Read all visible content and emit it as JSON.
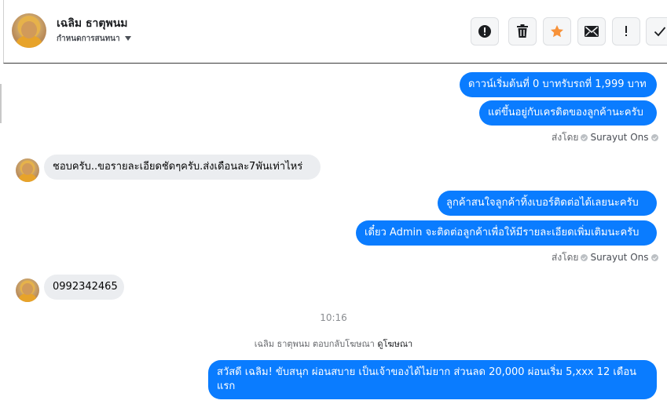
{
  "header": {
    "contact_name": "เฉลิม ธาตุพนม",
    "status_label": "กำหนดการสนทนา",
    "actions": [
      {
        "icon": "alert-circle-icon",
        "tooltip": "Spam"
      },
      {
        "icon": "trash-icon",
        "tooltip": "Delete"
      },
      {
        "icon": "star-icon",
        "tooltip": "Star",
        "color": "#f7923a"
      },
      {
        "icon": "envelope-icon",
        "tooltip": "Mark unread"
      },
      {
        "icon": "exclamation-icon",
        "tooltip": "Follow up"
      },
      {
        "icon": "check-icon",
        "tooltip": "Done"
      }
    ]
  },
  "messages": {
    "m1": "ดาวน์เริ่มต้นที่ 0 บาทรับรถที่ 1,999 บาท",
    "m2": "แต่ขึ้นอยู่กับเครดิตของลูกค้านะครับ",
    "sent_by_1": {
      "prefix": "ส่งโดย",
      "author": "Surayut Ons"
    },
    "m3": "ชอบครับ..ขอรายละเอียดชัดๆครับ.ส่งเดือนละ7พันเท่าไหร่",
    "m4": "ลูกค้าสนใจลูกค้าทิ้งเบอร์ติดต่อได้เลยนะครับ",
    "m5": "เดี๋ยว Admin จะติดต่อลูกค้าเพื่อให้มีรายละเอียดเพิ่มเติมนะครับ",
    "sent_by_2": {
      "prefix": "ส่งโดย",
      "author": "Surayut Ons"
    },
    "m6": "0992342465",
    "timestamp": "10:16",
    "reply_note": {
      "text": "เฉลิม ธาตุพนม ตอบกลับโฆษณา",
      "link": "ดูโฆษณา"
    },
    "m7": "สวัสดี เฉลิม! ขับสนุก ผ่อนสบาย เป็นเจ้าของได้ไม่ยาก ส่วนลด 20,000 ผ่อนเริ่ม 5,xxx 12 เดือน แรก"
  },
  "colors": {
    "outgoing_bubble": "#0a7cff",
    "incoming_bubble": "#ebedf0",
    "star_accent": "#f7923a"
  }
}
